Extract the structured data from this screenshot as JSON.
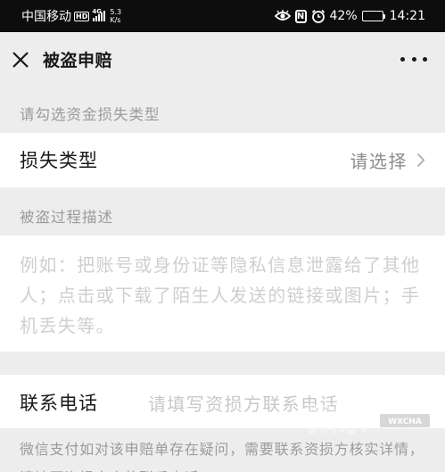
{
  "status_bar": {
    "carrier": "中国移动",
    "hd_badge": "HD",
    "network": "4G",
    "speed_value": "5.3",
    "speed_unit": "K/s",
    "nfc": "N",
    "battery_percent": "42%",
    "battery_level": 0.42,
    "time": "14:21"
  },
  "header": {
    "title": "被盗申赔"
  },
  "section1": {
    "label": "请勾选资金损失类型",
    "row_label": "损失类型",
    "row_value": "请选择"
  },
  "section2": {
    "label": "被盗过程描述",
    "placeholder": "例如：把账号或身份证等隐私信息泄露给了其他人；点击或下载了陌生人发送的链接或图片；手机丢失等。"
  },
  "section3": {
    "row_label": "联系电话",
    "placeholder": "请填写资损方联系电话"
  },
  "footer": {
    "note": "微信支付如对该申赔单存在疑问，需要联系资损方核实详情，请填写资损方本的联系电话。"
  },
  "watermark": {
    "text": "WXCHA",
    "glyphs": "微茶"
  }
}
